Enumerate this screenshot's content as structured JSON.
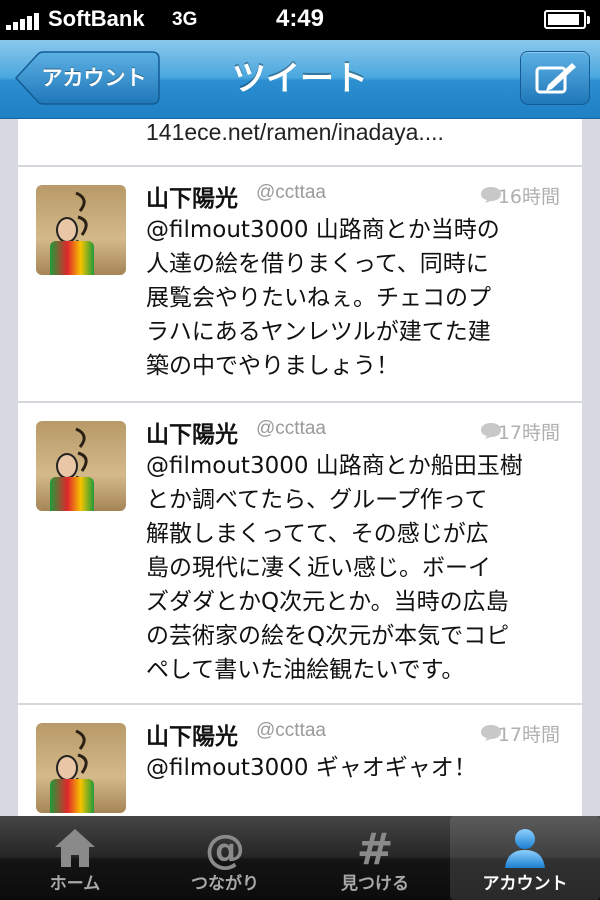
{
  "status_bar": {
    "carrier": "SoftBank",
    "network": "3G",
    "time": "4:49",
    "battery_level": 0.9
  },
  "nav": {
    "back_label": "アカウント",
    "title": "ツイート",
    "compose_icon": "compose-icon"
  },
  "link_row": {
    "text": "141ece.net/ramen/inadaya...."
  },
  "tweets": [
    {
      "name": "山下陽光",
      "handle": "@ccttaa",
      "time": "16時間",
      "lines": [
        "@filmout3000 山路商とか当時の",
        "人達の絵を借りまくって、同時に",
        "展覧会やりたいねぇ。チェコのプ",
        "ラハにあるヤンレツルが建てた建",
        "築の中でやりましょう！"
      ]
    },
    {
      "name": "山下陽光",
      "handle": "@ccttaa",
      "time": "17時間",
      "lines": [
        "@filmout3000 山路商とか船田玉樹",
        "とか調べてたら、グループ作って",
        "解散しまくってて、その感じが広",
        "島の現代に凄く近い感じ。ボーイ",
        "ズダダとかQ次元とか。当時の広島",
        "の芸術家の絵をQ次元が本気でコピ",
        "ペして書いた油絵観たいです。"
      ]
    },
    {
      "name": "山下陽光",
      "handle": "@ccttaa",
      "time": "17時間",
      "lines": [
        "@filmout3000 ギャオギャオ！"
      ]
    }
  ],
  "tabs": [
    {
      "label": "ホーム",
      "icon": "home-icon",
      "active": false
    },
    {
      "label": "つながり",
      "icon": "at-icon",
      "active": false
    },
    {
      "label": "見つける",
      "icon": "hashtag-icon",
      "active": false
    },
    {
      "label": "アカウント",
      "icon": "person-icon",
      "active": true
    }
  ],
  "colors": {
    "nav_blue": "#2c8fd0",
    "tab_active": "#3d9be0"
  }
}
